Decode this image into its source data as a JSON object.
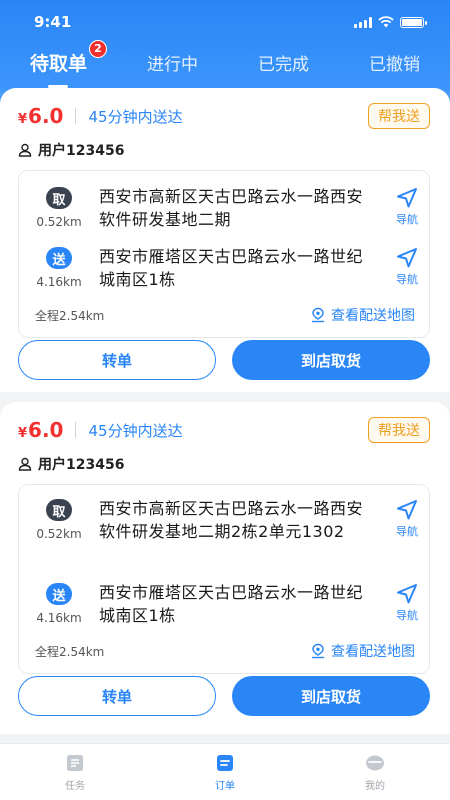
{
  "status": {
    "time": "9:41"
  },
  "tabs": [
    {
      "label": "待取单",
      "badge": "2"
    },
    {
      "label": "进行中"
    },
    {
      "label": "已完成"
    },
    {
      "label": "已撤销"
    }
  ],
  "orders": [
    {
      "currency": "¥",
      "price": "6.0",
      "eta": "45分钟内送达",
      "tag": "帮我送",
      "user": "用户123456",
      "pickup": {
        "badge": "取",
        "distance": "0.52km",
        "address": "西安市高新区天古巴路云水一路西安软件研发基地二期",
        "nav": "导航"
      },
      "dropoff": {
        "badge": "送",
        "distance": "4.16km",
        "address": "西安市雁塔区天古巴路云水一路世纪城南区1栋",
        "nav": "导航"
      },
      "total": "全程2.54km",
      "map_link": "查看配送地图",
      "transfer": "转单",
      "arrive": "到店取货"
    },
    {
      "currency": "¥",
      "price": "6.0",
      "eta": "45分钟内送达",
      "tag": "帮我送",
      "user": "用户123456",
      "pickup": {
        "badge": "取",
        "distance": "0.52km",
        "address": "西安市高新区天古巴路云水一路西安软件研发基地二期2栋2单元1302",
        "nav": "导航"
      },
      "dropoff": {
        "badge": "送",
        "distance": "4.16km",
        "address": "西安市雁塔区天古巴路云水一路世纪城南区1栋",
        "nav": "导航"
      },
      "total": "全程2.54km",
      "map_link": "查看配送地图",
      "transfer": "转单",
      "arrive": "到店取货"
    }
  ],
  "tabbar": [
    {
      "label": "任务",
      "icon": "task-icon"
    },
    {
      "label": "订单",
      "icon": "order-icon"
    },
    {
      "label": "我的",
      "icon": "profile-icon"
    }
  ],
  "colors": {
    "primary": "#2a86f7",
    "price": "#f23030",
    "tag": "#f0a020"
  }
}
